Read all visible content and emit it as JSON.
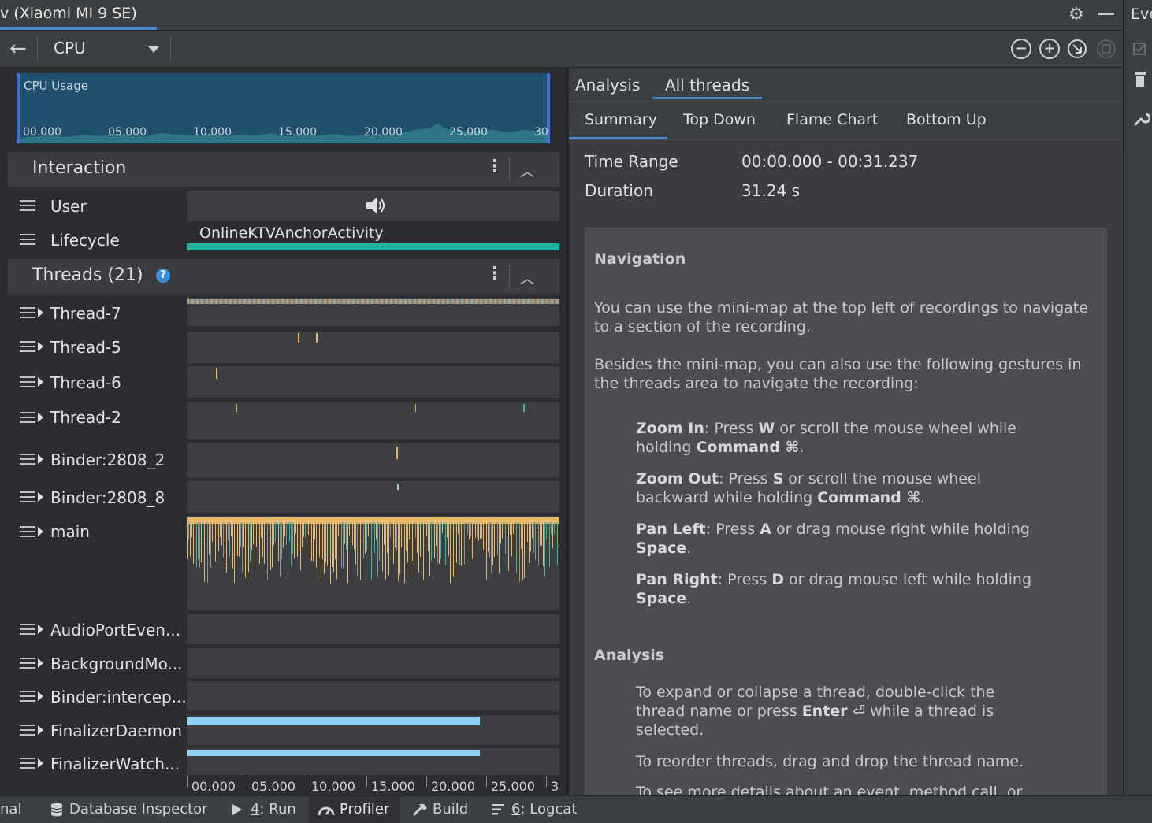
{
  "window": {
    "title": "v (Xiaomi MI 9 SE)",
    "right_strip_label": "Eve"
  },
  "toolbar": {
    "back_icon": "arrow-left-icon",
    "profiler_select_value": "CPU",
    "zoom_out_icon": "zoom-out-icon",
    "zoom_in_icon": "zoom-in-icon",
    "reset_zoom_icon": "reset-zoom-icon",
    "attach_icon": "attach-icon"
  },
  "minimap": {
    "label": "CPU Usage",
    "ticks": [
      "00.000",
      "05.000",
      "10.000",
      "15.000",
      "20.000",
      "25.000",
      "30"
    ]
  },
  "interaction": {
    "title": "Interaction",
    "rows": [
      {
        "label": "User",
        "icon": "speaker-icon"
      },
      {
        "label": "Lifecycle",
        "activity": "OnlineKTVAnchorActivity"
      }
    ]
  },
  "threads": {
    "title": "Threads (21)",
    "help_icon": "question-icon",
    "rows": [
      {
        "name": "Thread-7"
      },
      {
        "name": "Thread-5"
      },
      {
        "name": "Thread-6"
      },
      {
        "name": "Thread-2"
      },
      {
        "name": "Binder:2808_2"
      },
      {
        "name": "Binder:2808_8"
      },
      {
        "name": "main"
      },
      {
        "name": "AudioPortEven..."
      },
      {
        "name": "BackgroundMo..."
      },
      {
        "name": "Binder:intercep..."
      },
      {
        "name": "FinalizerDaemon"
      },
      {
        "name": "FinalizerWatch..."
      }
    ]
  },
  "timeline_axis": {
    "ticks": [
      "00.000",
      "05.000",
      "10.000",
      "15.000",
      "20.000",
      "25.000",
      "3("
    ]
  },
  "right_panel": {
    "top_tabs": [
      {
        "label": "Analysis"
      },
      {
        "label": "All threads",
        "selected": true
      }
    ],
    "sub_tabs": [
      {
        "label": "Summary",
        "selected": true
      },
      {
        "label": "Top Down"
      },
      {
        "label": "Flame Chart"
      },
      {
        "label": "Bottom Up"
      }
    ],
    "summary": {
      "time_range_label": "Time Range",
      "time_range_value": "00:00.000 - 00:31.237",
      "duration_label": "Duration",
      "duration_value": "31.24 s"
    },
    "help": {
      "nav_heading": "Navigation",
      "nav_p1": "You can use the mini-map at the top left of recordings to navigate to a section of the recording.",
      "nav_p2": "Besides the mini-map, you can also use the following gestures in the threads area to navigate the recording:",
      "zoom_in_term": "Zoom In",
      "zoom_in_text_a": ": Press ",
      "zoom_in_key": "W",
      "zoom_in_text_b": " or scroll the mouse wheel while holding ",
      "zoom_in_mod": "Command ⌘",
      "zoom_out_term": "Zoom Out",
      "zoom_out_text_a": ": Press ",
      "zoom_out_key": "S",
      "zoom_out_text_b": " or scroll the mouse wheel backward while holding ",
      "zoom_out_mod": "Command ⌘",
      "pan_left_term": "Pan Left",
      "pan_left_text_a": ": Press ",
      "pan_left_key": "A",
      "pan_left_text_b": " or drag mouse right while holding ",
      "pan_left_mod": "Space",
      "pan_right_term": "Pan Right",
      "pan_right_text_a": ": Press ",
      "pan_right_key": "D",
      "pan_right_text_b": " or drag mouse left while holding ",
      "pan_right_mod": "Space",
      "analysis_heading": "Analysis",
      "analysis_p1_a": "To expand or collapse a thread, double-click the thread name or press ",
      "analysis_p1_key": "Enter ⏎",
      "analysis_p1_b": " while a thread is selected.",
      "analysis_p2": "To reorder threads, drag and drop the thread name.",
      "analysis_p3": "To see more details about an event, method call, or"
    }
  },
  "bottom_bar": {
    "items": [
      {
        "label": "nal"
      },
      {
        "label": "Database Inspector",
        "icon": "database-icon"
      },
      {
        "prefix": "4",
        "label": ": Run",
        "icon": "run-icon"
      },
      {
        "label": "Profiler",
        "icon": "profiler-icon",
        "selected": true
      },
      {
        "label": "Build",
        "icon": "hammer-icon"
      },
      {
        "prefix": "6",
        "label": ": Logcat",
        "icon": "logcat-icon"
      }
    ]
  },
  "colors": {
    "accent": "#4a88c7",
    "lifecycle_bar": "#1fb3a0",
    "cpu_area": "#2f7d8a",
    "main_thread_activity": "#e8b86a",
    "finalizer_bar": "#8fd1f4"
  }
}
